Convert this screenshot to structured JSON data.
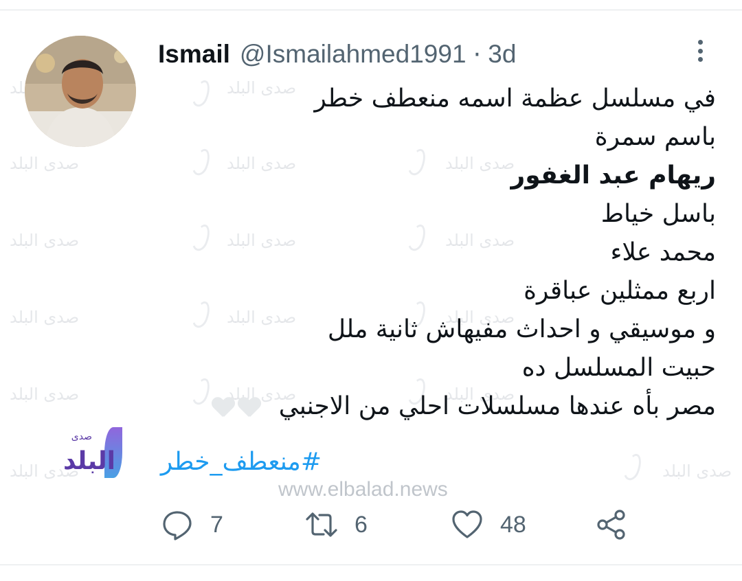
{
  "tweet": {
    "name": "Ismail",
    "handle": "@Ismailahmed1991",
    "separator": "·",
    "time": "3d",
    "lines": [
      "في مسلسل عظمة اسمه منعطف خطر",
      "باسم سمرة",
      "ريهام عبد الغفور",
      "باسل خياط",
      "محمد علاء",
      "اربع ممثلين عباقرة",
      "و موسيقي و احداث مفيهاش ثانية ملل",
      "حبيت المسلسل ده",
      "مصر بأه عندها مسلسلات احلي من الاجنبي"
    ],
    "hashtag": "#منعطف_خطر",
    "stats": {
      "replies": "7",
      "retweets": "6",
      "likes": "48"
    }
  },
  "watermark": {
    "text": "صدى البلد",
    "logo_text": "البلد",
    "logo_small": "صدى",
    "site": "www.elbalad.news"
  },
  "colors": {
    "link": "#1d9bf0",
    "muted": "#536471",
    "text": "#0f1419",
    "brand": "#5b3aa6"
  },
  "icons": [
    "more-vertical-icon",
    "reply-icon",
    "retweet-icon",
    "like-icon",
    "share-icon",
    "heart-emoji-icon"
  ]
}
